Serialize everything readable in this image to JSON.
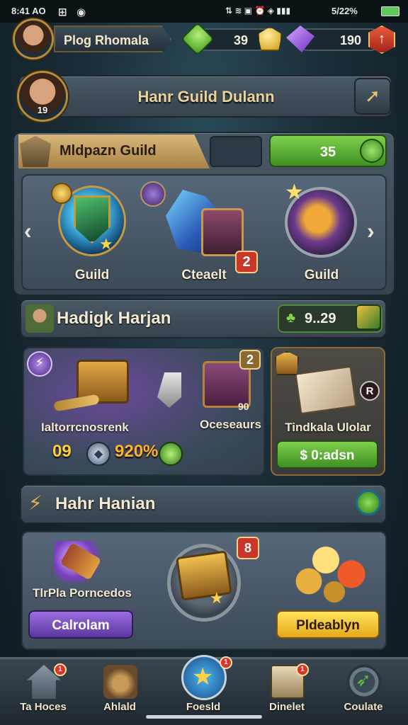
{
  "status_bar": {
    "time": "8:41 AO",
    "battery": "5/22%"
  },
  "top_bar": {
    "player_name": "Plog Rhomala",
    "green_currency": "39",
    "purple_currency": "190"
  },
  "guild_header": {
    "title": "Hanr Guild Dulann",
    "avatar_level": "19"
  },
  "guild_section": {
    "tab_title": "Mldpazn Guild",
    "green_value": "35",
    "cards": [
      {
        "label": "Guild"
      },
      {
        "label": "Cteaelt",
        "badge": "2"
      },
      {
        "label": "Guild"
      }
    ]
  },
  "hadigk_section": {
    "title": "Hadigk Harjan",
    "value": "9..29",
    "left_card": {
      "item1_label": "Ialtorrcnosrenk",
      "item2_label": "Oceseaurs",
      "item2_count": "90",
      "badge": "2",
      "stat_a": "09",
      "stat_b": "920%"
    },
    "right_card": {
      "label": "Tindkala Ulolar",
      "badge": "R",
      "button": "$ 0:adsn"
    }
  },
  "hanr_section": {
    "title": "Hahr Hanian",
    "left": {
      "label": "TlrPla Porncedos",
      "button": "Calrolam"
    },
    "mid_badge": "8",
    "right": {
      "button": "Pldeablyn"
    }
  },
  "nav": [
    {
      "label": "Ta Hoces",
      "badge": "1"
    },
    {
      "label": "Ahlald"
    },
    {
      "label": "Foesld",
      "badge": "1"
    },
    {
      "label": "Dinelet",
      "badge": "1"
    },
    {
      "label": "Coulate"
    }
  ],
  "colors": {
    "accent_gold": "#d9b77a",
    "panel": "#44525e",
    "green": "#5fb337",
    "purple": "#7a52c4"
  }
}
